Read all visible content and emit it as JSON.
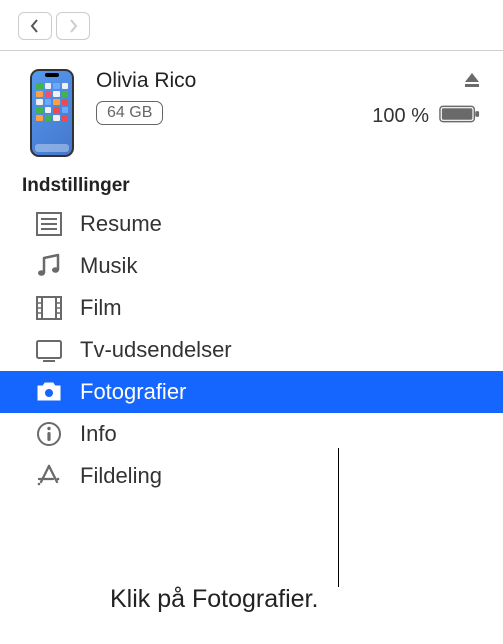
{
  "device": {
    "name": "Olivia Rico",
    "capacity": "64 GB",
    "battery_percent": "100 %"
  },
  "section_header": "Indstillinger",
  "settings": {
    "items": [
      {
        "label": "Resume",
        "icon": "list-icon",
        "selected": false
      },
      {
        "label": "Musik",
        "icon": "music-icon",
        "selected": false
      },
      {
        "label": "Film",
        "icon": "film-icon",
        "selected": false
      },
      {
        "label": "Tv-udsendelser",
        "icon": "tv-icon",
        "selected": false
      },
      {
        "label": "Fotografier",
        "icon": "camera-icon",
        "selected": true
      },
      {
        "label": "Info",
        "icon": "info-icon",
        "selected": false
      },
      {
        "label": "Fildeling",
        "icon": "appstore-icon",
        "selected": false
      }
    ]
  },
  "callout": "Klik på Fotografier."
}
